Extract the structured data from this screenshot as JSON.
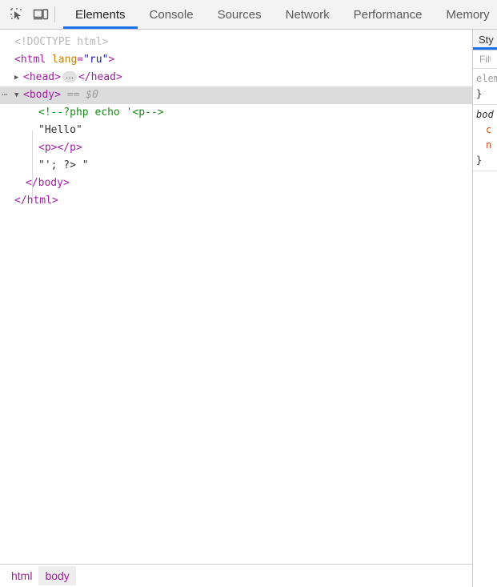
{
  "toolbar": {
    "icons": [
      {
        "name": "inspect-element-icon",
        "title": "Inspect element"
      },
      {
        "name": "device-toolbar-icon",
        "title": "Toggle device toolbar"
      }
    ],
    "tabs": [
      {
        "label": "Elements",
        "active": true
      },
      {
        "label": "Console",
        "active": false
      },
      {
        "label": "Sources",
        "active": false
      },
      {
        "label": "Network",
        "active": false
      },
      {
        "label": "Performance",
        "active": false
      },
      {
        "label": "Memory",
        "active": false
      }
    ]
  },
  "dom": {
    "line_doctype": "<!DOCTYPE html>",
    "line_html_open_tag": "<html",
    "line_html_attr_name": "lang",
    "line_html_attr_eq": "=",
    "line_html_attr_value": "\"ru\"",
    "line_html_close_bracket": ">",
    "line_head_open": "<head>",
    "line_head_ellipsis": "…",
    "line_head_close": "</head>",
    "line_body_open": "<body>",
    "line_body_marker": "== $0",
    "line_php_comment": "<!--?php echo '<p-->",
    "line_text_hello": "\"Hello\"",
    "line_p_tags": "<p></p>",
    "line_text_close": "\"'; ?> \"",
    "line_body_close": "</body>",
    "line_html_close": "</html>",
    "gutter_dots": "⋯",
    "twisty_collapsed": "▶",
    "twisty_expanded": "▼"
  },
  "sidebar": {
    "tabs": [
      {
        "label": "Sty",
        "active": true
      }
    ],
    "filter_placeholder": "Filte",
    "rules": [
      {
        "selector": "elem",
        "selector_style": "gray",
        "close": "}",
        "props": []
      },
      {
        "selector": "bod",
        "selector_style": "dark",
        "close": "}",
        "props": [
          "c",
          "n"
        ]
      }
    ]
  },
  "breadcrumb": {
    "items": [
      {
        "label": "html",
        "active": false
      },
      {
        "label": "body",
        "active": true
      }
    ]
  },
  "colors": {
    "accent": "#1a73e8",
    "tag": "#a020a0",
    "attr_name": "#c5820a",
    "attr_value": "#1a1aa6",
    "comment": "#1a8a1a",
    "selected_row": "#dcdcdc",
    "toolbar_bg": "#f3f3f3"
  }
}
